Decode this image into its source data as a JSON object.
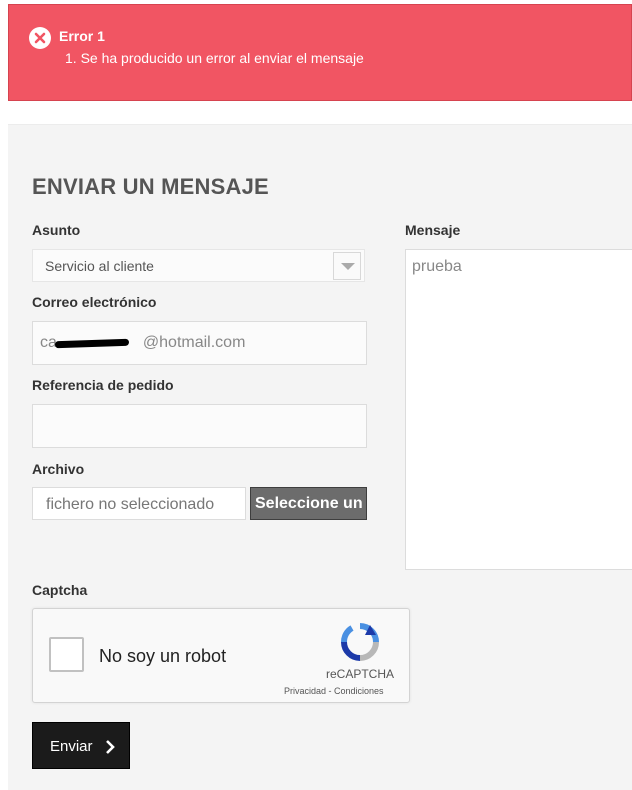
{
  "alert": {
    "title": "Error 1",
    "message": "1. Se ha producido un error al enviar el mensaje",
    "color": "#f15563"
  },
  "form": {
    "heading": "ENVIAR UN MENSAJE",
    "subject_label": "Asunto",
    "subject_value": "Servicio al cliente",
    "email_label": "Correo electrónico",
    "email_value": "ca•••••••@hotmail.com",
    "email_value_visible_suffix": "@hotmail.com",
    "email_value_visible_prefix": "ca",
    "order_ref_label": "Referencia de pedido",
    "order_ref_value": "",
    "file_label": "Archivo",
    "file_placeholder": "fichero no seleccionado",
    "file_button": "Seleccione un",
    "message_label": "Mensaje",
    "message_value": "prueba",
    "captcha_label": "Captcha",
    "submit_label": "Enviar"
  },
  "captcha": {
    "checkbox_text": "No soy un robot",
    "brand": "reCAPTCHA",
    "links": "Privacidad - Condiciones"
  }
}
